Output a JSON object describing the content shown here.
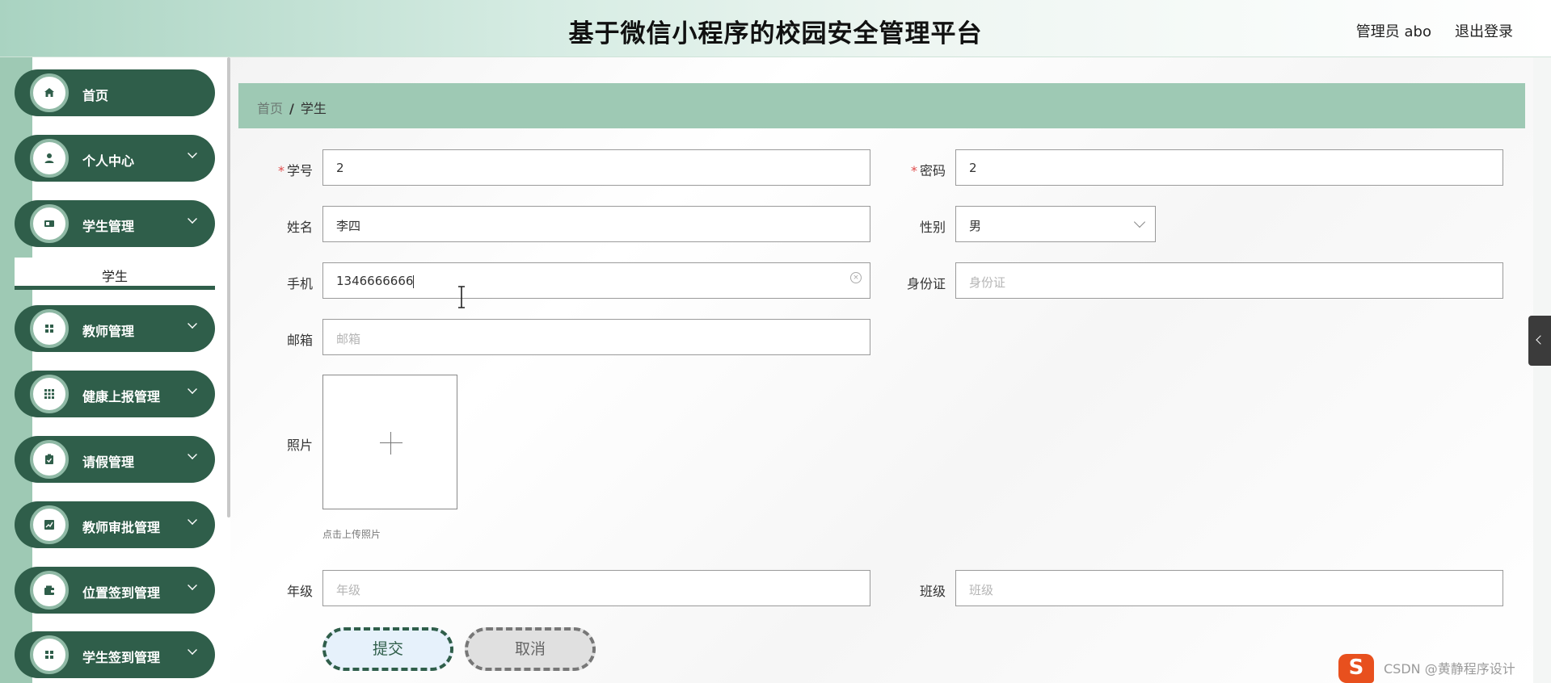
{
  "header": {
    "title": "基于微信小程序的校园安全管理平台",
    "user": "管理员 abo",
    "logout": "退出登录"
  },
  "sidebar": {
    "items": [
      {
        "label": "首页",
        "icon": "home-icon",
        "glyph": "⌂",
        "expandable": false
      },
      {
        "label": "个人中心",
        "icon": "user-icon",
        "glyph": "●",
        "expandable": true
      },
      {
        "label": "学生管理",
        "icon": "id-card-icon",
        "glyph": "▪",
        "expandable": true
      },
      {
        "label": "教师管理",
        "icon": "grid-icon",
        "glyph": "▦",
        "expandable": true
      },
      {
        "label": "健康上报管理",
        "icon": "apps-icon",
        "glyph": "▦",
        "expandable": true
      },
      {
        "label": "请假管理",
        "icon": "clipboard-icon",
        "glyph": "▣",
        "expandable": true
      },
      {
        "label": "教师审批管理",
        "icon": "chart-icon",
        "glyph": "▨",
        "expandable": true
      },
      {
        "label": "位置签到管理",
        "icon": "wallet-icon",
        "glyph": "▤",
        "expandable": true
      },
      {
        "label": "学生签到管理",
        "icon": "grid-icon",
        "glyph": "▦",
        "expandable": true
      }
    ],
    "submenu_active": "学生"
  },
  "breadcrumb": {
    "home": "首页",
    "separator": "/",
    "current": "学生"
  },
  "form": {
    "xuehao": {
      "label": "学号",
      "value": "2",
      "required": true
    },
    "mima": {
      "label": "密码",
      "value": "2",
      "required": true
    },
    "xingming": {
      "label": "姓名",
      "value": "李四"
    },
    "xingbie": {
      "label": "性别",
      "value": "男"
    },
    "shouji": {
      "label": "手机",
      "value": "1346666666"
    },
    "shenfenzheng": {
      "label": "身份证",
      "placeholder": "身份证"
    },
    "youxiang": {
      "label": "邮箱",
      "placeholder": "邮箱"
    },
    "zhaopian": {
      "label": "照片",
      "tip": "点击上传照片"
    },
    "nianji": {
      "label": "年级",
      "placeholder": "年级"
    },
    "banji": {
      "label": "班级",
      "placeholder": "班级"
    }
  },
  "buttons": {
    "submit": "提交",
    "cancel": "取消"
  },
  "overlay": {
    "watermark": "CSDN @黄静程序设计",
    "ime_logo": "S"
  },
  "colors": {
    "primary": "#2f5e4a",
    "accent_light": "#9ec9b4",
    "required": "#e04b4b"
  }
}
